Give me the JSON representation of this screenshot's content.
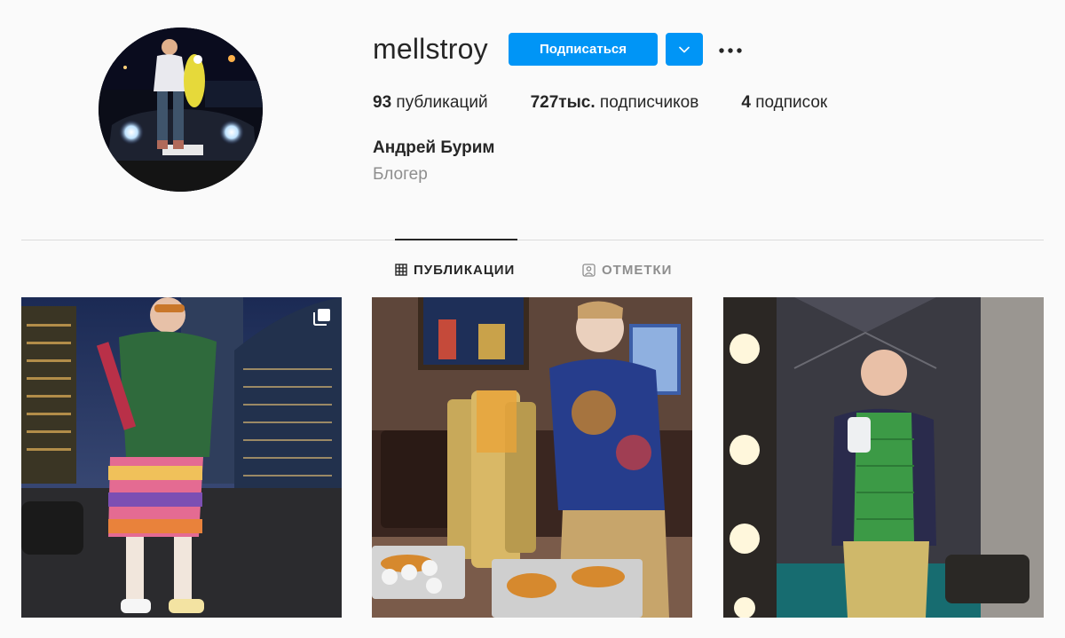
{
  "profile": {
    "username": "mellstroy",
    "follow_label": "Подписаться",
    "stats": {
      "posts_count": "93",
      "posts_label": "публикаций",
      "followers_count": "727тыс.",
      "followers_label": "подписчиков",
      "following_count": "4",
      "following_label": "подписок"
    },
    "full_name": "Андрей Бурим",
    "category": "Блогер"
  },
  "icons": {
    "dropdown": "chevron-down-icon",
    "more": "more-options-icon",
    "posts_tab": "grid-icon",
    "tagged_tab": "tagged-icon",
    "multi_post": "carousel-icon"
  },
  "tabs": [
    {
      "label": "ПУБЛИКАЦИИ",
      "active": true
    },
    {
      "label": "ОТМЕТКИ",
      "active": false
    }
  ],
  "posts": [
    {
      "multiple": true
    },
    {
      "multiple": false
    },
    {
      "multiple": false
    }
  ],
  "colors": {
    "accent": "#0095f6",
    "text": "#262626",
    "secondary_text": "#8e8e8e",
    "divider": "#dbdbdb",
    "background": "#fafafa"
  }
}
